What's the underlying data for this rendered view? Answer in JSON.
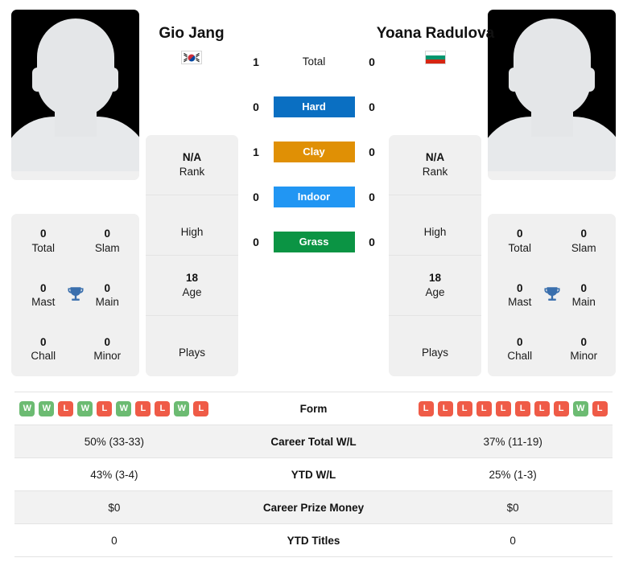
{
  "players": {
    "left": {
      "name": "Gio Jang",
      "card_name": "Gio Jang",
      "flag": "south-korea-flag",
      "rank_value": "N/A",
      "rank_label": "Rank",
      "high_value": "",
      "high_label": "High",
      "age_value": "18",
      "age_label": "Age",
      "plays_value": "",
      "plays_label": "Plays",
      "titles": [
        {
          "value": "0",
          "label": "Total"
        },
        {
          "value": "0",
          "label": "Slam"
        },
        {
          "value": "0",
          "label": "Mast"
        },
        {
          "value": "0",
          "label": "Main"
        },
        {
          "value": "0",
          "label": "Chall"
        },
        {
          "value": "0",
          "label": "Minor"
        }
      ],
      "form": [
        "W",
        "W",
        "L",
        "W",
        "L",
        "W",
        "L",
        "L",
        "W",
        "L"
      ],
      "career_total_wl": "50% (33-33)",
      "ytd_wl": "43% (3-4)",
      "career_prize_money": "$0",
      "ytd_titles": "0"
    },
    "right": {
      "name": "Yoana Radulova",
      "card_name": "Yoana Radulova",
      "flag": "bulgaria-flag",
      "rank_value": "N/A",
      "rank_label": "Rank",
      "high_value": "",
      "high_label": "High",
      "age_value": "18",
      "age_label": "Age",
      "plays_value": "",
      "plays_label": "Plays",
      "titles": [
        {
          "value": "0",
          "label": "Total"
        },
        {
          "value": "0",
          "label": "Slam"
        },
        {
          "value": "0",
          "label": "Mast"
        },
        {
          "value": "0",
          "label": "Main"
        },
        {
          "value": "0",
          "label": "Chall"
        },
        {
          "value": "0",
          "label": "Minor"
        }
      ],
      "form": [
        "L",
        "L",
        "L",
        "L",
        "L",
        "L",
        "L",
        "L",
        "W",
        "L"
      ],
      "career_total_wl": "37% (11-19)",
      "ytd_wl": "25% (1-3)",
      "career_prize_money": "$0",
      "ytd_titles": "0"
    }
  },
  "head_to_head": {
    "rows": [
      {
        "left": "1",
        "label": "Total",
        "right": "0",
        "color": ""
      },
      {
        "left": "0",
        "label": "Hard",
        "right": "0",
        "color": "#0a6fc2"
      },
      {
        "left": "1",
        "label": "Clay",
        "right": "0",
        "color": "#e09005"
      },
      {
        "left": "0",
        "label": "Indoor",
        "right": "0",
        "color": "#2196f3"
      },
      {
        "left": "0",
        "label": "Grass",
        "right": "0",
        "color": "#0b9444"
      }
    ]
  },
  "stats_table": {
    "rows": [
      {
        "label": "Form",
        "type": "form"
      },
      {
        "label": "Career Total W/L",
        "type": "text",
        "key": "career_total_wl"
      },
      {
        "label": "YTD W/L",
        "type": "text",
        "key": "ytd_wl"
      },
      {
        "label": "Career Prize Money",
        "type": "text",
        "key": "career_prize_money"
      },
      {
        "label": "YTD Titles",
        "type": "text",
        "key": "ytd_titles"
      }
    ]
  },
  "colors": {
    "win": "#6cbb72",
    "loss": "#ef5b47",
    "card_bg": "#f0f0f0",
    "trophy": "#3a6fad"
  }
}
